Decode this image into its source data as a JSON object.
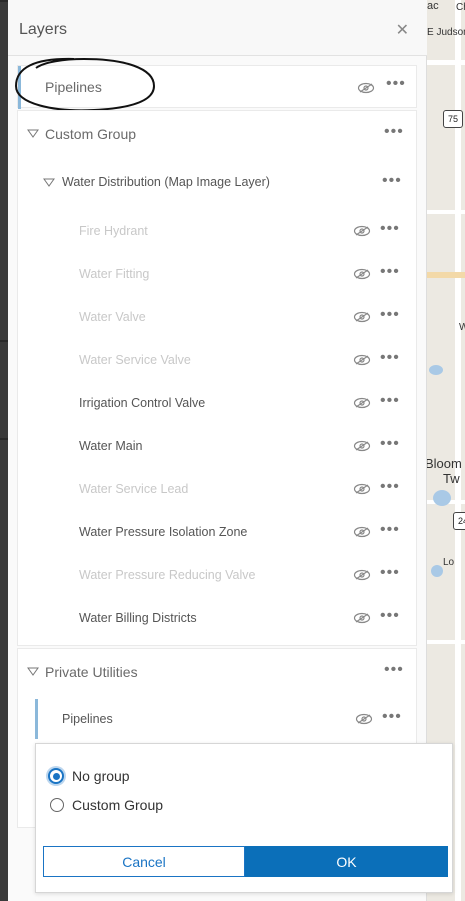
{
  "panel": {
    "title": "Layers",
    "close_icon": "close-icon"
  },
  "top_layer": {
    "label": "Pipelines"
  },
  "custom_group": {
    "label": "Custom Group",
    "sublayer_group": {
      "label": "Water Distribution (Map Image Layer)",
      "items": [
        {
          "label": "Fire Hydrant",
          "visible": false
        },
        {
          "label": "Water Fitting",
          "visible": false
        },
        {
          "label": "Water Valve",
          "visible": false
        },
        {
          "label": "Water Service Valve",
          "visible": false
        },
        {
          "label": "Irrigation Control Valve",
          "visible": true
        },
        {
          "label": "Water Main",
          "visible": true
        },
        {
          "label": "Water Service Lead",
          "visible": false
        },
        {
          "label": "Water Pressure Isolation Zone",
          "visible": true
        },
        {
          "label": "Water Pressure Reducing Valve",
          "visible": false
        },
        {
          "label": "Water Billing Districts",
          "visible": true
        }
      ]
    }
  },
  "private_utilities": {
    "label": "Private Utilities",
    "child": {
      "label": "Pipelines"
    }
  },
  "dialog": {
    "options": [
      "No group",
      "Custom Group"
    ],
    "selected": "No group",
    "cancel_label": "Cancel",
    "ok_label": "OK"
  },
  "map": {
    "labels": [
      "ac",
      "Ch",
      "E Judson",
      "75",
      "Bloom",
      "Tw",
      "24",
      "Lo",
      "W"
    ]
  },
  "colors": {
    "accent": "#8bb8da",
    "primary": "#0b6fb9"
  }
}
